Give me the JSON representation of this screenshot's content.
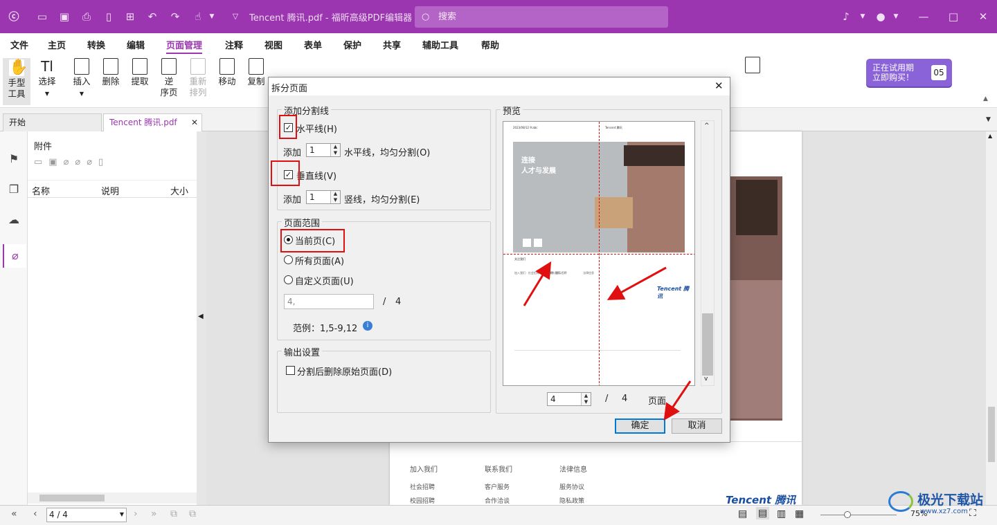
{
  "titlebar": {
    "doc_title": "Tencent 腾讯.pdf - 福昕高级PDF编辑器",
    "search_placeholder": "搜索",
    "icons": [
      "app-logo-icon",
      "open-icon",
      "save-icon",
      "print-icon",
      "new-icon",
      "export-icon",
      "undo-icon",
      "redo-icon",
      "hand-icon",
      "dropdown-icon",
      "bell-icon",
      "user-icon",
      "minimize-icon",
      "maximize-icon",
      "close-icon"
    ]
  },
  "menu": [
    "文件",
    "主页",
    "转换",
    "编辑",
    "页面管理",
    "注释",
    "视图",
    "表单",
    "保护",
    "共享",
    "辅助工具",
    "帮助"
  ],
  "menu_active": "页面管理",
  "ribbon": {
    "hand": "手型",
    "hand2": "工具",
    "select": "选择",
    "insert": "插入",
    "delete": "删除",
    "extract": "提取",
    "reverse": "逆",
    "reverse2": "序页",
    "rearrange": "重新",
    "rearrange2": "排列",
    "move": "移动",
    "copy": "复制"
  },
  "trial": {
    "line1": "正在试用期",
    "line2": "立即购买！",
    "days": "05"
  },
  "tabs": {
    "start": "开始",
    "doc": "Tencent 腾讯.pdf"
  },
  "attachments": {
    "title": "附件",
    "col_name": "名称",
    "col_desc": "说明",
    "col_size": "大小"
  },
  "page_preview": {
    "join_us": "加入我们",
    "contact_us": "联系我们",
    "legal": "法律信息",
    "r1": [
      "社会招聘",
      "客户服务",
      "服务协议"
    ],
    "r2": [
      "校园招聘",
      "合作洽谈",
      "隐私政策"
    ],
    "logo": "Tencent 腾讯"
  },
  "status": {
    "page": "4 / 4",
    "zoom": "75%"
  },
  "watermark": {
    "text": "极光下载站",
    "url": "www.xz7.com"
  },
  "dialog": {
    "title": "拆分页面",
    "group_lines": "添加分割线",
    "horizontal": "水平线(H)",
    "add1": "添加",
    "h_count": "1",
    "h_suffix": "水平线，均匀分割(O)",
    "vertical": "垂直线(V)",
    "add2": "添加",
    "v_count": "1",
    "v_suffix": "竖线，均匀分割(E)",
    "group_range": "页面范围",
    "current": "当前页(C)",
    "all": "所有页面(A)",
    "custom": "自定义页面(U)",
    "custom_value": "4,",
    "slash": "/",
    "total": "4",
    "example": "范例：1,5-9,12",
    "group_output": "输出设置",
    "delete_original": "分割后删除原始页面(D)",
    "group_preview": "预览",
    "preview_page": "4",
    "preview_total": "4",
    "preview_slash": "/",
    "page_word": "页面",
    "ok": "确定",
    "cancel": "取消"
  },
  "preview_doc": {
    "date": "2023/08/12 9:abc",
    "brand": "Tencent 腾讯",
    "hero1": "连接",
    "hero2": "人才与发展",
    "follow": "关注我们",
    "logo": "Tencent 腾讯"
  }
}
